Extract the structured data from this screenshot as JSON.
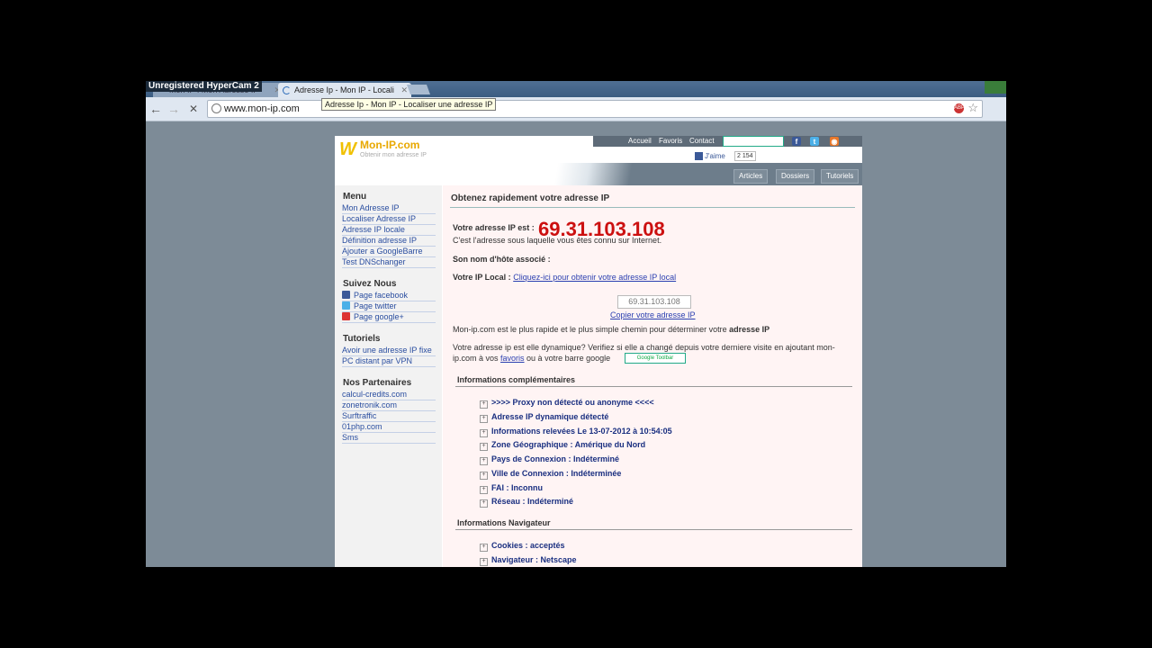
{
  "browser": {
    "hypercam_banner": "Unregistered HyperCam 2",
    "tabs": [
      {
        "label": "Mon IP : Mon Adresse IP"
      },
      {
        "label": "Adresse Ip - Mon IP - Locali"
      }
    ],
    "url": "www.mon-ip.com",
    "tooltip": "Adresse Ip - Mon IP - Localiser une adresse IP"
  },
  "header": {
    "logo_mark": "W",
    "logo_title": "Mon-IP.com",
    "logo_sub": "Obtenir mon adresse IP",
    "nav": [
      "Accueil",
      "Favoris",
      "Contact"
    ],
    "google_toolbar": "Google Toolbar",
    "like_label": "J'aime",
    "like_count": "2 154",
    "tabs": [
      "Articles",
      "Dossiers",
      "Tutoriels"
    ]
  },
  "sidebar": {
    "menu_title": "Menu",
    "menu": [
      "Mon Adresse IP",
      "Localiser Adresse IP",
      "Adresse IP locale",
      "Définition adresse IP",
      "Ajouter a GoogleBarre",
      "Test DNSchanger"
    ],
    "follow_title": "Suivez Nous",
    "follow": [
      "Page facebook",
      "Page twitter",
      "Page google+"
    ],
    "tutorials_title": "Tutoriels",
    "tutorials": [
      "Avoir une adresse IP fixe",
      "PC distant par VPN"
    ],
    "partners_title": "Nos Partenaires",
    "partners": [
      "calcul-credits.com",
      "zonetronik.com",
      "Surftraffic",
      "01php.com",
      "Sms"
    ]
  },
  "content": {
    "title": "Obtenez rapidement votre adresse IP",
    "ip_label": "Votre adresse IP est :",
    "ip": "69.31.103.108",
    "ip_desc": "C'est l'adresse sous laquelle vous êtes connu sur Internet.",
    "hostname_label": "Son nom d'hôte associé :",
    "local_label": "Votre IP Local :",
    "local_link": "Cliquez-ici pour obtenir votre adresse IP local",
    "ip_box": "69.31.103.108",
    "copy_link": "Copier votre adresse IP",
    "fastest_pre": "Mon-ip.com est le plus rapide et le plus simple chemin pour déterminer votre ",
    "fastest_bold": "adresse IP",
    "dynamic_line1": "Votre adresse ip est elle dynamique? Verifiez si elle a changé depuis votre derniere visite en ajoutant mon-",
    "dynamic_line2_pre": "ip.com à vos ",
    "favoris_link": "favoris",
    "dynamic_line2_post": " ou à votre barre google",
    "section_info": "Informations complémentaires",
    "info_items": [
      ">>>> Proxy non détecté ou anonyme <<<<",
      "Adresse IP dynamique détecté",
      "Informations relevées Le 13-07-2012 à 10:54:05",
      "Zone Géographique : Amérique du Nord",
      "Pays de Connexion : Indéterminé",
      "Ville de Connexion : Indéterminée",
      "FAI : Inconnu",
      "Réseau : Indéterminé"
    ],
    "section_nav": "Informations Navigateur",
    "nav_items": [
      "Cookies : acceptés",
      "Navigateur : Netscape"
    ]
  }
}
